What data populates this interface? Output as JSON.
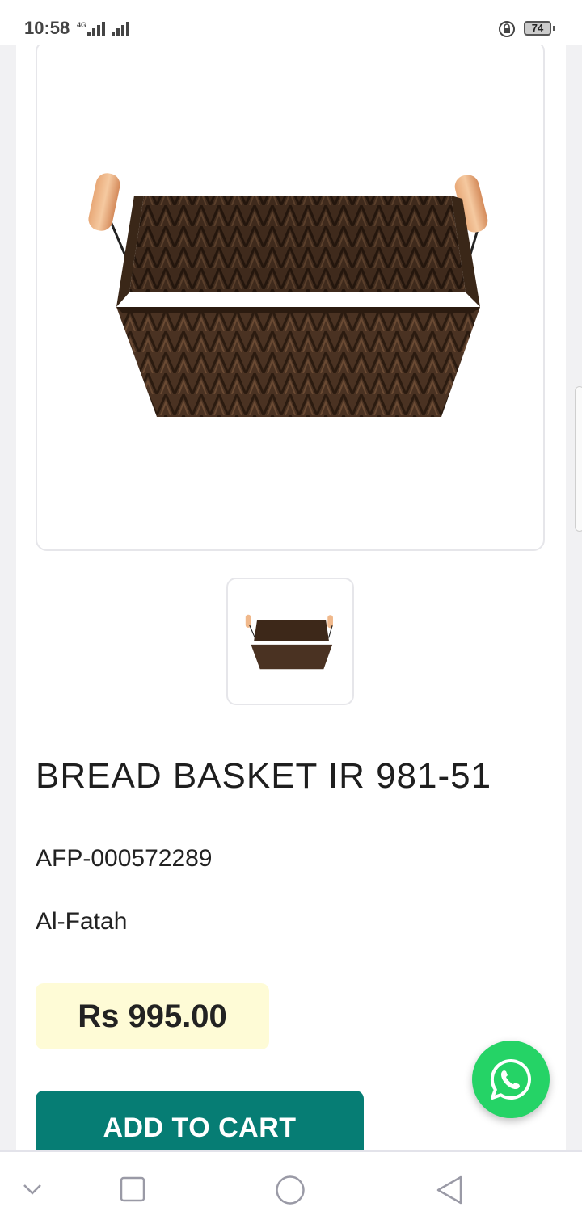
{
  "status_bar": {
    "time": "10:58",
    "network": "4G",
    "battery": "74"
  },
  "product": {
    "title": "BREAD BASKET IR 981-51",
    "sku": "AFP-000572289",
    "brand": "Al-Fatah",
    "price": "Rs 995.00"
  },
  "actions": {
    "add_to_cart": "ADD TO CART"
  },
  "icons": {
    "whatsapp": "whatsapp-icon",
    "nav_down": "chevron-down-icon",
    "nav_recents": "square-icon",
    "nav_home": "circle-icon",
    "nav_back": "triangle-back-icon"
  },
  "colors": {
    "accent": "#067d74",
    "price_bg": "#fefbd6",
    "whatsapp": "#25d366"
  }
}
